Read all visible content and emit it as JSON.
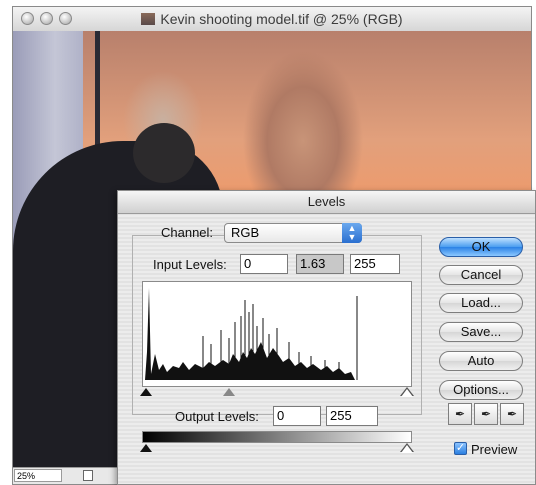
{
  "document": {
    "title": "Kevin shooting model.tif @ 25% (RGB)",
    "zoom": "25%"
  },
  "levels_dialog": {
    "title": "Levels",
    "channel_label": "Channel:",
    "channel_value": "RGB",
    "input_levels_label": "Input Levels:",
    "input_black": "0",
    "input_gamma": "1.63",
    "input_white": "255",
    "output_levels_label": "Output Levels:",
    "output_black": "0",
    "output_white": "255",
    "buttons": {
      "ok": "OK",
      "cancel": "Cancel",
      "load": "Load...",
      "save": "Save...",
      "auto": "Auto",
      "options": "Options..."
    },
    "preview_label": "Preview",
    "preview_checked": true
  },
  "colors": {
    "accent_blue": "#2b82e6"
  }
}
